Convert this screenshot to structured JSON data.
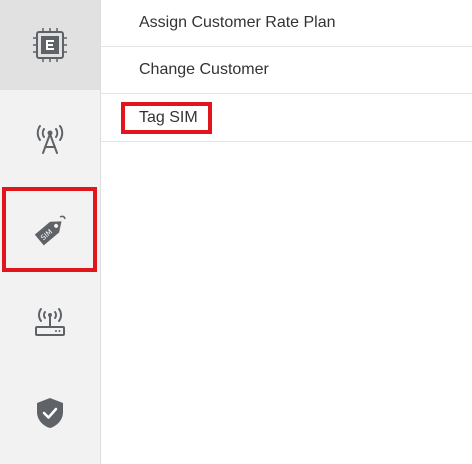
{
  "sidebar": {
    "items": [
      {
        "icon": "e-chip-icon"
      },
      {
        "icon": "cell-tower-icon"
      },
      {
        "icon": "sim-tag-icon"
      },
      {
        "icon": "router-icon"
      },
      {
        "icon": "shield-check-icon"
      }
    ],
    "sim_tag_text": "SIM"
  },
  "menu": {
    "items": [
      {
        "label": "Assign Customer Rate Plan"
      },
      {
        "label": "Change Customer"
      },
      {
        "label": "Tag SIM"
      }
    ]
  },
  "colors": {
    "highlight": "#e0161c",
    "icon": "#5f6368",
    "sidebar_bg": "#f2f2f2"
  }
}
